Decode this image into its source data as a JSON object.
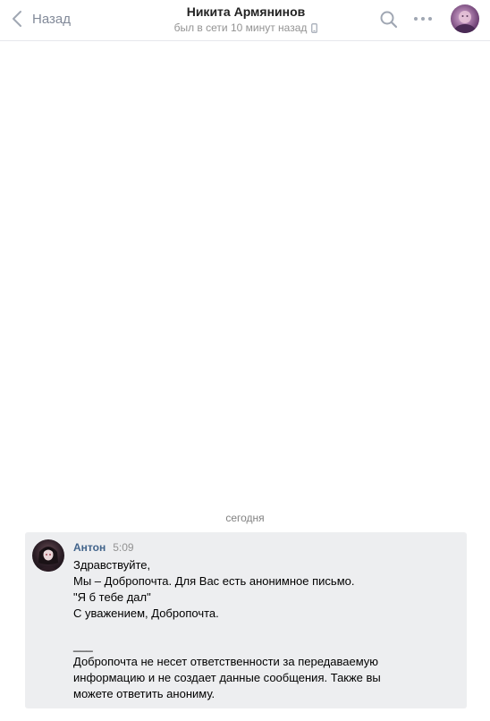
{
  "header": {
    "back_label": "Назад",
    "title": "Никита Армянинов",
    "subtitle": "был в сети 10 минут назад"
  },
  "icons": {
    "back": "chevron-left-icon",
    "search": "search-icon",
    "more": "more-dots-icon",
    "status": "mobile-phone-icon"
  },
  "conversation": {
    "date_separator": "сегодня",
    "messages": [
      {
        "author": "Антон",
        "time": "5:09",
        "lines": [
          "Здравствуйте,",
          "Мы – Добропочта. Для Вас есть анонимное письмо.",
          "\"Я б тебе дал\"",
          "С уважением, Добропочта.",
          "",
          "___",
          "Добропочта не несет ответственности за передаваемую",
          "информацию и не создает данные сообщения. Также вы",
          "можете ответить анониму."
        ]
      }
    ]
  },
  "colors": {
    "author_link": "#42648b",
    "message_bg": "#edeef0",
    "muted_text": "#939393"
  }
}
